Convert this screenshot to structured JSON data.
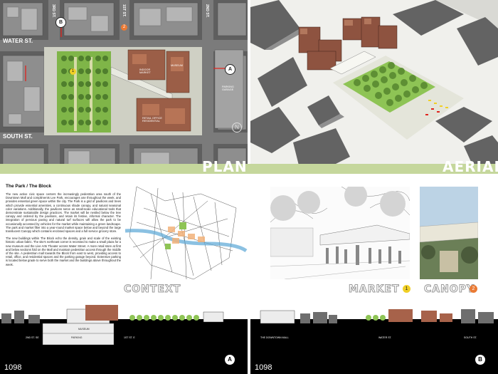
{
  "plan": {
    "title": "PLAN",
    "streets": {
      "water": "WATER ST.",
      "south": "SOUTH ST.",
      "first": "1ST ST.",
      "second": "2ND ST.",
      "third": "3RD ST."
    },
    "buildings": {
      "indoor_market": "INDOOR MARKET",
      "museum": "MUSEUM",
      "retail": "RETAIL OFFICE RESIDENTIAL",
      "parking": "PARKING GARAGE"
    },
    "markers": [
      "B",
      "A",
      "1",
      "2"
    ]
  },
  "aerial": {
    "title": "AERIAL"
  },
  "park": {
    "heading": "The Park / The Block",
    "para1": "The new active civic space centers the increasingly pedestrian area south of the Downtown Mall and compliments Lee Park, encourages use throughout the week, and provides essential green space within the city. The Park is a grid of pavilions and trees which provide essential amenities, a continuous shade canopy, and natural seasonal color variations. Additionally, the pavilions serve as small-scale educational tools that demonstrate sustainable design practices. The market will be nestled below the tree canopy and ordered by the pavilions, and retain its festive, informal character. The integration of pervious paving and natural turf surfaces will allow the park to be occasionally accessed by vehicles for the market while maintaining a green landscape. The park and market filter into a year-round market space below and beyond the large translucent Canopy which contains enclosed spaces and a full service grocery store.",
    "para2": "The new buildings within The Block echo the density, grain and scale of the existing historic urban fabric. The site's northeast corner is recessed to make a small plaza for a new museum and the Live Arts Theater across Water Street. A more retail store at first and below sections fold on the Mall and maintain pedestrian access through the middle of the site. A pedestrian mall towards the Block from east to west, providing access to retail, office, and residential spaces and the parking garage beyond. Extensive parking is located below grade to serve both the market and the buildings above throughout the week."
  },
  "captions": {
    "context": "CONTEXT",
    "market": "MARKET",
    "market_num": "1",
    "canopy": "CANOPY",
    "canopy_num": "2"
  },
  "sections": {
    "left_marker": "A",
    "right_marker": "B",
    "left_labels": [
      "2ND ST. SE",
      "MUSEUM",
      "PARKING",
      "1ST ST. E"
    ],
    "right_labels": [
      "THE DOWNTOWN MALL",
      "WATER ST.",
      "SOUTH ST."
    ]
  },
  "page_numbers": {
    "left": "1098",
    "right": "1098"
  },
  "colors": {
    "green_band": "#c5d79c",
    "accent_yellow": "#f0cf26",
    "accent_orange": "#ea7a34",
    "marker_red": "#e0241e",
    "black_band": "#000000"
  }
}
